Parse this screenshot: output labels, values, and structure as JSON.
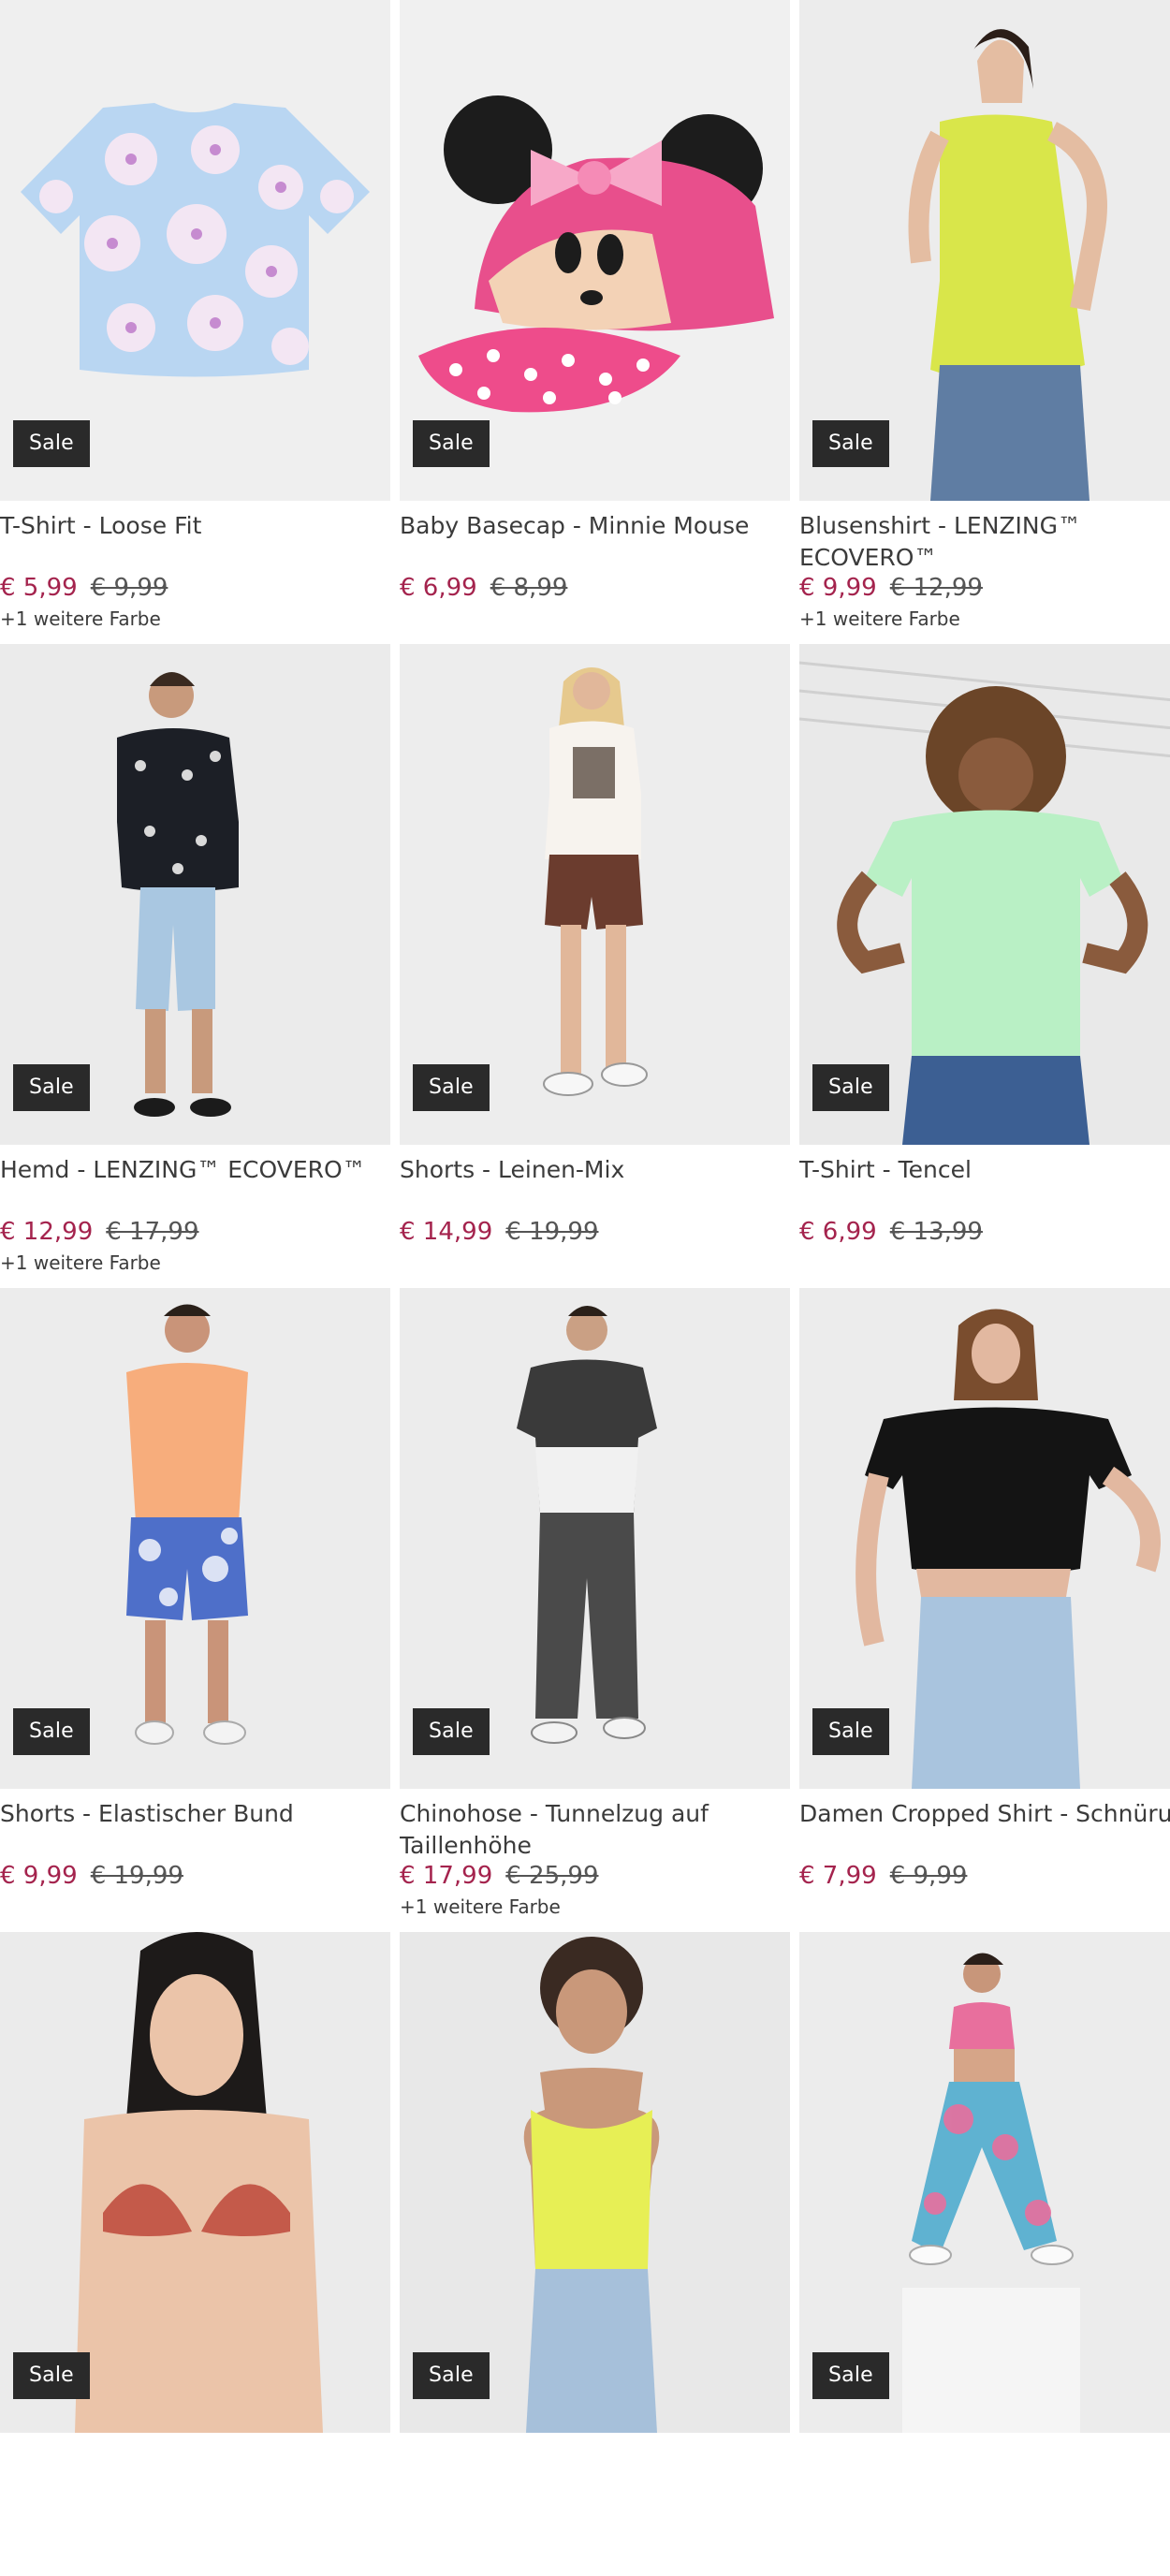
{
  "sale_label": "Sale",
  "colors": {
    "sale_price": "#a4234d",
    "badge_bg": "#2a2a2a"
  },
  "products": [
    {
      "name": "T-Shirt - Loose Fit",
      "price": "€ 5,99",
      "old_price": "€ 9,99",
      "more_colors": "+1 weitere Farbe",
      "image": "floral-tshirt"
    },
    {
      "name": "Baby Basecap - Minnie Mouse",
      "price": "€ 6,99",
      "old_price": "€ 8,99",
      "more_colors": "",
      "image": "minnie-cap"
    },
    {
      "name": "Blusenshirt - LENZING™ ECOVERO™",
      "price": "€ 9,99",
      "old_price": "€ 12,99",
      "more_colors": "+1 weitere Farbe",
      "image": "lime-blouse"
    },
    {
      "name": "Hemd - LENZING™ ECOVERO™",
      "price": "€ 12,99",
      "old_price": "€ 17,99",
      "more_colors": "+1 weitere Farbe",
      "image": "bandana-shirt"
    },
    {
      "name": "Shorts - Leinen-Mix",
      "price": "€ 14,99",
      "old_price": "€ 19,99",
      "more_colors": "",
      "image": "linen-shorts"
    },
    {
      "name": "T-Shirt - Tencel",
      "price": "€ 6,99",
      "old_price": "€ 13,99",
      "more_colors": "",
      "image": "mint-tshirt"
    },
    {
      "name": "Shorts - Elastischer Bund",
      "price": "€ 9,99",
      "old_price": "€ 19,99",
      "more_colors": "",
      "image": "tie-dye-shorts"
    },
    {
      "name": "Chinohose - Tunnelzug auf Taillenhöhe",
      "price": "€ 17,99",
      "old_price": "€ 25,99",
      "more_colors": "+1 weitere Farbe",
      "image": "chino-pants"
    },
    {
      "name": "Damen Cropped Shirt - Schnürung",
      "price": "€ 7,99",
      "old_price": "€ 9,99",
      "more_colors": "",
      "image": "black-crop-top"
    },
    {
      "name": "",
      "price": "",
      "old_price": "",
      "more_colors": "",
      "image": "red-bikini"
    },
    {
      "name": "",
      "price": "",
      "old_price": "",
      "more_colors": "",
      "image": "yellow-tank"
    },
    {
      "name": "",
      "price": "",
      "old_price": "",
      "more_colors": "",
      "image": "sports-set"
    }
  ]
}
